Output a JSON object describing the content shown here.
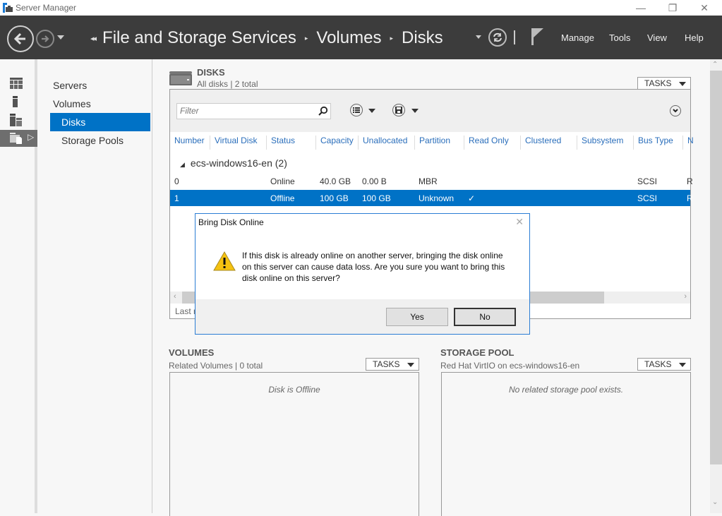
{
  "window": {
    "title": "Server Manager",
    "controls": {
      "minimize": "—",
      "restore": "❐",
      "close": "✕"
    }
  },
  "header": {
    "breadcrumb": [
      "File and Storage Services",
      "Volumes",
      "Disks"
    ],
    "breadcrumb_lead": "◂◂",
    "separator": "▸",
    "menu": [
      "Manage",
      "Tools",
      "View",
      "Help"
    ]
  },
  "leftbar": {
    "icons": [
      "dashboard-icon",
      "local-server-icon",
      "all-servers-icon",
      "file-storage-services-icon"
    ],
    "active_index": 3,
    "expand_arrow": "▷"
  },
  "navpane": {
    "items": [
      {
        "label": "Servers",
        "sub": false,
        "selected": false
      },
      {
        "label": "Volumes",
        "sub": false,
        "selected": false
      },
      {
        "label": "Disks",
        "sub": true,
        "selected": true
      },
      {
        "label": "Storage Pools",
        "sub": true,
        "selected": false
      }
    ]
  },
  "disks": {
    "title": "DISKS",
    "subtitle": "All disks | 2 total",
    "tasks_label": "TASKS",
    "filter_placeholder": "Filter",
    "columns": [
      "Number",
      "Virtual Disk",
      "Status",
      "Capacity",
      "Unallocated",
      "Partition",
      "Read Only",
      "Clustered",
      "Subsystem",
      "Bus Type",
      "N"
    ],
    "group": "ecs-windows16-en (2)",
    "group_toggle": "◢",
    "rows": [
      {
        "number": "0",
        "virtual_disk": "",
        "status": "Online",
        "capacity": "40.0 GB",
        "unallocated": "0.00 B",
        "partition": "MBR",
        "read_only": "",
        "clustered": "",
        "subsystem": "",
        "bus_type": "SCSI",
        "n": "R",
        "selected": false
      },
      {
        "number": "1",
        "virtual_disk": "",
        "status": "Offline",
        "capacity": "100 GB",
        "unallocated": "100 GB",
        "partition": "Unknown",
        "read_only": "✓",
        "clustered": "",
        "subsystem": "",
        "bus_type": "SCSI",
        "n": "R",
        "selected": true
      }
    ],
    "footer": "Last r",
    "scroll_left": "‹",
    "scroll_right": "›"
  },
  "volumes": {
    "title": "VOLUMES",
    "subtitle": "Related Volumes | 0 total",
    "tasks_label": "TASKS",
    "empty_message": "Disk is Offline"
  },
  "storage_pool": {
    "title": "STORAGE POOL",
    "subtitle": "Red Hat VirtIO on ecs-windows16-en",
    "tasks_label": "TASKS",
    "empty_message": "No related storage pool exists."
  },
  "dialog": {
    "title": "Bring Disk Online",
    "close": "✕",
    "message": "If this disk is already online on another server, bringing the disk online on this server can cause data loss. Are you sure you want to bring this disk online on this server?",
    "yes_label": "Yes",
    "no_label": "No"
  },
  "scrollbar": {
    "up": "⌃",
    "down": "⌄"
  },
  "colors": {
    "accent": "#0072c6",
    "header_bg": "#3c3c3c",
    "dialog_border": "#2b7dd4"
  }
}
